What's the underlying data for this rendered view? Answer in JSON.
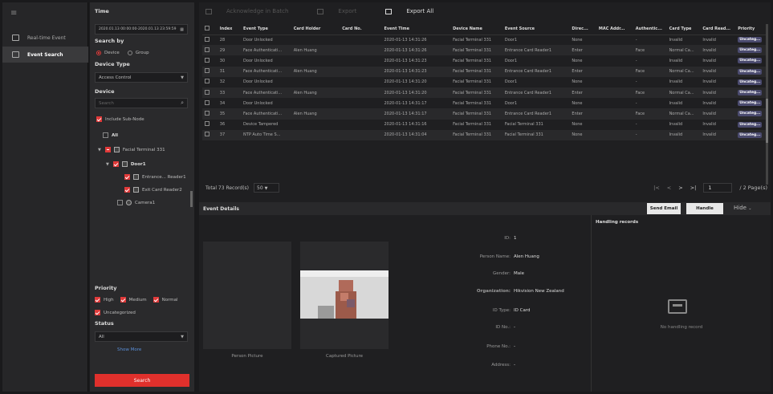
{
  "nav": {
    "items": [
      {
        "label": "Real-time Event"
      },
      {
        "label": "Event Search"
      }
    ]
  },
  "filter": {
    "time_label": "Time",
    "time_value": "2020.01.13 00:00:00-2020.01.13 23:59:59",
    "search_by_label": "Search by",
    "search_by_device": "Device",
    "search_by_group": "Group",
    "device_type_label": "Device Type",
    "device_type_value": "Access Control",
    "device_label": "Device",
    "search_placeholder": "Search",
    "include_subnode": "Include Sub-Node",
    "tree_all": "All",
    "tree_terminal": "Facial Terminal 331",
    "tree_door": "Door1",
    "tree_entrance": "Entrance... Reader1",
    "tree_exit": "Exit Card Reader2",
    "tree_camera": "Camera1",
    "priority_label": "Priority",
    "priority_high": "High",
    "priority_medium": "Medium",
    "priority_normal": "Normal",
    "priority_uncat": "Uncategorized",
    "status_label": "Status",
    "status_value": "All",
    "show_more": "Show More",
    "search_button": "Search"
  },
  "toolbar": {
    "ack": "Acknowledge in Batch",
    "export": "Export",
    "export_all": "Export All"
  },
  "table": {
    "headers": [
      "",
      "Index",
      "Event Type",
      "Card Holder",
      "Card No.",
      "Event Time",
      "Device Name",
      "Event Source",
      "Direc...",
      "MAC Addr...",
      "Authentic...",
      "Card Type",
      "Card Read...",
      "Priority"
    ],
    "rows": [
      [
        "28",
        "Door Unlocked",
        "",
        "",
        "2020-01-13 14:31:26",
        "Facial Terminal 331",
        "Door1",
        "None",
        "",
        "-",
        "Invalid",
        "Invalid",
        "Uncateg..."
      ],
      [
        "29",
        "Face Authenticati...",
        "Alen Huang",
        "",
        "2020-01-13 14:31:26",
        "Facial Terminal 331",
        "Entrance Card Reader1",
        "Enter",
        "",
        "Face",
        "Normal Ca...",
        "Invalid",
        "Uncateg..."
      ],
      [
        "30",
        "Door Unlocked",
        "",
        "",
        "2020-01-13 14:31:23",
        "Facial Terminal 331",
        "Door1",
        "None",
        "",
        "-",
        "Invalid",
        "Invalid",
        "Uncateg..."
      ],
      [
        "31",
        "Face Authenticati...",
        "Alen Huang",
        "",
        "2020-01-13 14:31:23",
        "Facial Terminal 331",
        "Entrance Card Reader1",
        "Enter",
        "",
        "Face",
        "Normal Ca...",
        "Invalid",
        "Uncateg..."
      ],
      [
        "32",
        "Door Unlocked",
        "",
        "",
        "2020-01-13 14:31:20",
        "Facial Terminal 331",
        "Door1",
        "None",
        "",
        "-",
        "Invalid",
        "Invalid",
        "Uncateg..."
      ],
      [
        "33",
        "Face Authenticati...",
        "Alen Huang",
        "",
        "2020-01-13 14:31:20",
        "Facial Terminal 331",
        "Entrance Card Reader1",
        "Enter",
        "",
        "Face",
        "Normal Ca...",
        "Invalid",
        "Uncateg..."
      ],
      [
        "34",
        "Door Unlocked",
        "",
        "",
        "2020-01-13 14:31:17",
        "Facial Terminal 331",
        "Door1",
        "None",
        "",
        "-",
        "Invalid",
        "Invalid",
        "Uncateg..."
      ],
      [
        "35",
        "Face Authenticati...",
        "Alen Huang",
        "",
        "2020-01-13 14:31:17",
        "Facial Terminal 331",
        "Entrance Card Reader1",
        "Enter",
        "",
        "Face",
        "Normal Ca...",
        "Invalid",
        "Uncateg..."
      ],
      [
        "36",
        "Device Tampered",
        "",
        "",
        "2020-01-13 14:31:16",
        "Facial Terminal 331",
        "Facial Terminal 331",
        "None",
        "",
        "-",
        "Invalid",
        "Invalid",
        "Uncateg..."
      ],
      [
        "37",
        "NTP Auto Time S...",
        "",
        "",
        "2020-01-13 14:31:04",
        "Facial Terminal 331",
        "Facial Terminal 331",
        "None",
        "",
        "-",
        "Invalid",
        "Invalid",
        "Uncateg..."
      ]
    ]
  },
  "pager": {
    "total": "Total 73 Record(s)",
    "per_page": "50",
    "page": "1",
    "pages": "/ 2 Page(s)"
  },
  "details": {
    "title": "Event Details",
    "send_email": "Send Email",
    "handle": "Handle",
    "hide": "Hide",
    "person_picture": "Person Picture",
    "captured_picture": "Captured Picture",
    "fields": [
      {
        "k": "ID:",
        "v": "1"
      },
      {
        "k": "Person Name:",
        "v": "Alen Huang"
      },
      {
        "k": "Gender:",
        "v": "Male"
      },
      {
        "k": "Organization:",
        "v": "Hikvision New Zealand"
      },
      {
        "k": "ID Type:",
        "v": "ID Card"
      },
      {
        "k": "ID No.:",
        "v": "-"
      },
      {
        "k": "Phone No.:",
        "v": "-"
      },
      {
        "k": "Address:",
        "v": "-"
      }
    ],
    "handling_records": "Handling records",
    "no_record": "No handling record"
  }
}
